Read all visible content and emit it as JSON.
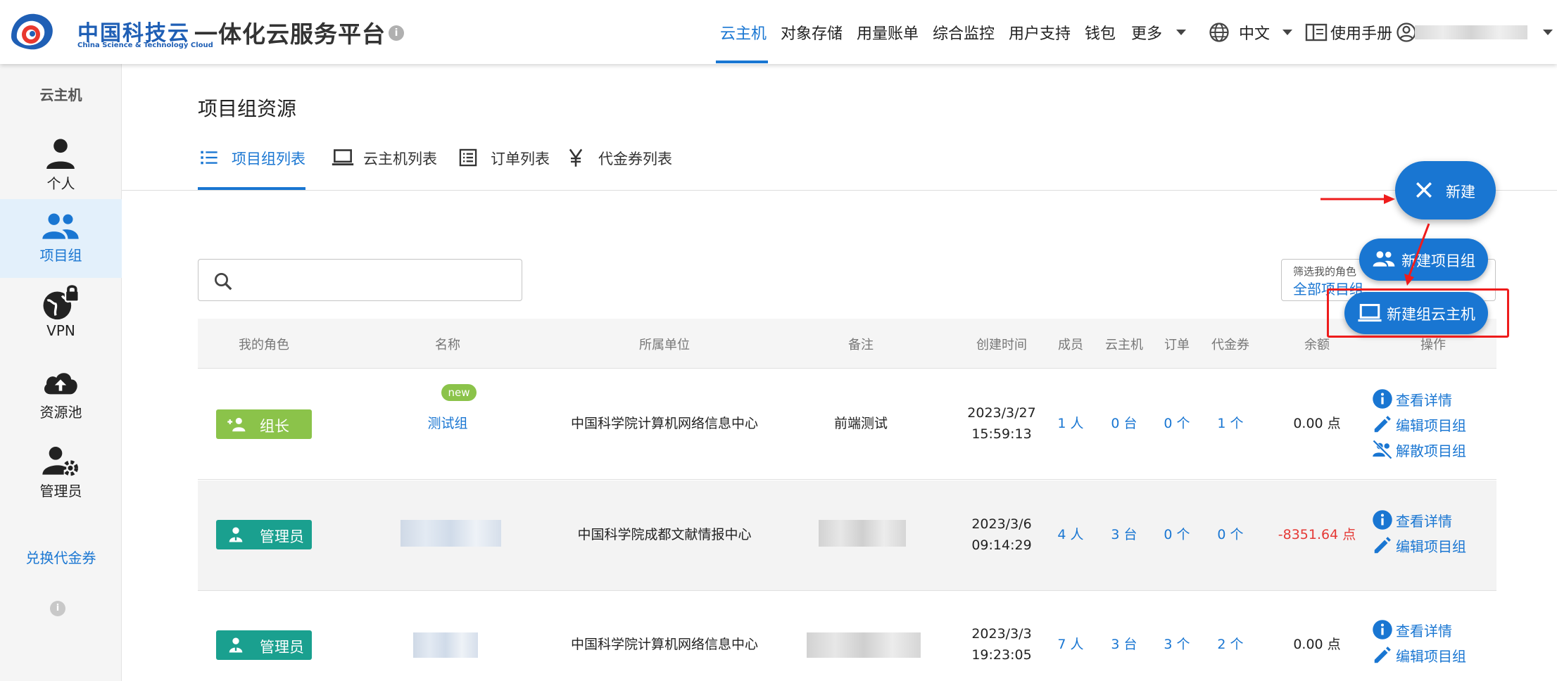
{
  "header": {
    "brand_cn": "中国科技云",
    "brand_en": "China Science & Technology Cloud",
    "platform_title": "一体化云服务平台",
    "nav": [
      "云主机",
      "对象存储",
      "用量账单",
      "综合监控",
      "用户支持",
      "钱包",
      "更多"
    ],
    "active_nav": "云主机",
    "language": "中文",
    "manual": "使用手册"
  },
  "sidebar": {
    "title": "云主机",
    "items": [
      {
        "label": "个人",
        "icon": "person-icon"
      },
      {
        "label": "项目组",
        "icon": "group-icon"
      },
      {
        "label": "VPN",
        "icon": "vpn-lock-icon"
      },
      {
        "label": "资源池",
        "icon": "cloud-upload-icon"
      },
      {
        "label": "管理员",
        "icon": "admin-gear-icon"
      }
    ],
    "active": "项目组",
    "exchange_link": "兑换代金券"
  },
  "main": {
    "title": "项目组资源",
    "tabs": [
      {
        "label": "项目组列表",
        "icon": "list-icon"
      },
      {
        "label": "云主机列表",
        "icon": "laptop-icon"
      },
      {
        "label": "订单列表",
        "icon": "order-list-icon"
      },
      {
        "label": "代金券列表",
        "icon": "yen-icon"
      }
    ],
    "active_tab": "项目组列表",
    "search_value": "",
    "filter": {
      "label": "筛选我的角色",
      "value": "全部项目组"
    }
  },
  "table": {
    "headers": [
      "我的角色",
      "名称",
      "所属单位",
      "备注",
      "创建时间",
      "成员",
      "云主机",
      "订单",
      "代金券",
      "余额",
      "操作"
    ],
    "rows": [
      {
        "role": "组长",
        "name": "测试组",
        "badge": "new",
        "org": "中国科学院计算机网络信息中心",
        "note": "前端测试",
        "date": "2023/3/27",
        "time": "15:59:13",
        "members": "1 人",
        "hosts": "0 台",
        "orders": "0 个",
        "vouchers": "1 个",
        "balance": "0.00 点",
        "actions": [
          "查看详情",
          "编辑项目组",
          "解散项目组"
        ]
      },
      {
        "role": "管理员",
        "name": "",
        "org": "中国科学院成都文献情报中心",
        "note": "",
        "date": "2023/3/6",
        "time": "09:14:29",
        "members": "4 人",
        "hosts": "3 台",
        "orders": "0 个",
        "vouchers": "0 个",
        "balance": "-8351.64 点",
        "actions": [
          "查看详情",
          "编辑项目组"
        ]
      },
      {
        "role": "管理员",
        "name": "",
        "org": "中国科学院计算机网络信息中心",
        "note": "",
        "date": "2023/3/3",
        "time": "19:23:05",
        "members": "7 人",
        "hosts": "3 台",
        "orders": "3 个",
        "vouchers": "2 个",
        "balance": "0.00 点",
        "actions": [
          "查看详情",
          "编辑项目组"
        ]
      }
    ]
  },
  "fab": {
    "main_label": "新建",
    "new_group_label": "新建项目组",
    "new_group_host_label": "新建组云主机"
  },
  "colors": {
    "primary": "#1976d2",
    "leader": "#8bc34a",
    "admin": "#1aa08f",
    "negative": "#e53935",
    "annotation": "#ee1c1c"
  }
}
